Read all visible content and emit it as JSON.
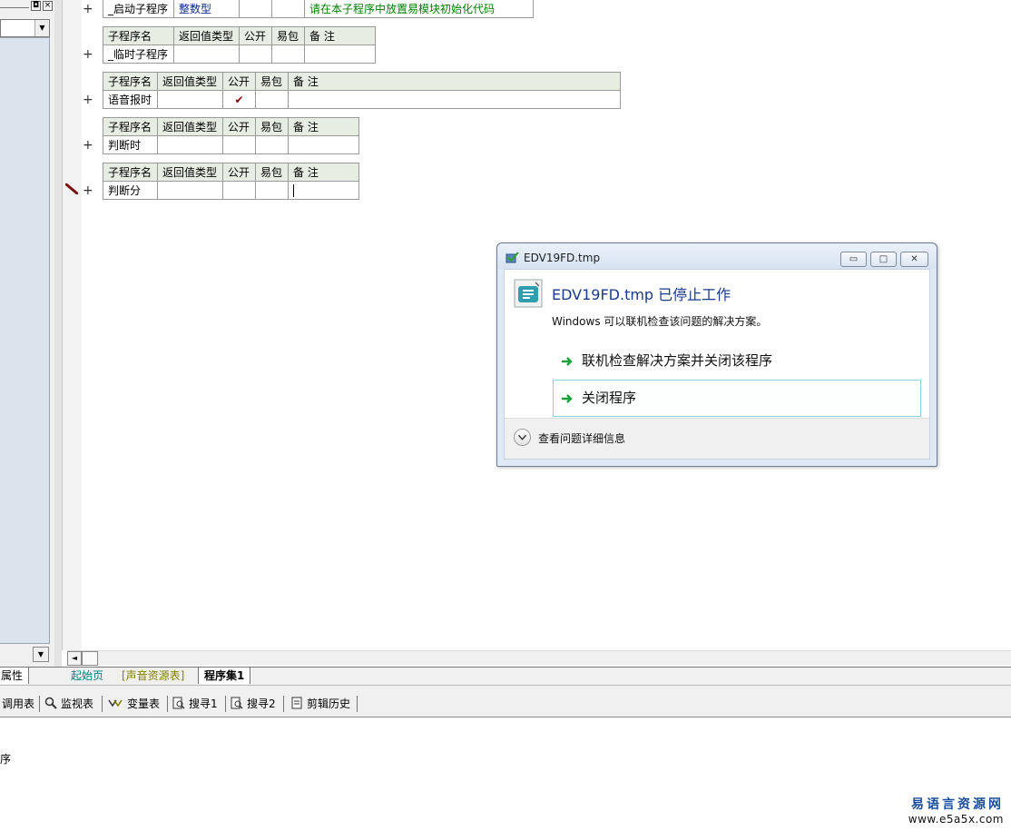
{
  "left_panel": {
    "restore_glyph": "◘",
    "close_glyph": "×",
    "combo_arrow": "▼",
    "scroll_arrow": "▼"
  },
  "editor": {
    "subroutines": [
      {
        "header": null,
        "row": [
          "_启动子程序",
          "整数型",
          "",
          "",
          "请在本子程序中放置易模块初始化代码"
        ]
      },
      {
        "header": [
          "子程序名",
          "返回值类型",
          "公开",
          "易包",
          "备 注"
        ],
        "row": [
          "_临时子程序",
          "",
          "",
          "",
          ""
        ]
      },
      {
        "header": [
          "子程序名",
          "返回值类型",
          "公开",
          "易包",
          "备 注"
        ],
        "row": [
          "语音报时",
          "",
          "✔",
          "",
          ""
        ]
      },
      {
        "header": [
          "子程序名",
          "返回值类型",
          "公开",
          "易包",
          "备 注"
        ],
        "row": [
          "判断时",
          "",
          "",
          "",
          ""
        ]
      },
      {
        "header": [
          "子程序名",
          "返回值类型",
          "公开",
          "易包",
          "备 注"
        ],
        "row": [
          "判断分",
          "",
          "",
          "",
          ""
        ]
      }
    ],
    "expand_glyph": "+",
    "scroll_left": "◄"
  },
  "tabs": {
    "properties": "属性",
    "start_page": "起始页",
    "sound_table": "[声音资源表]",
    "program_set": "程序集1"
  },
  "bottom_toolbar": {
    "items": [
      "调用表",
      "监视表",
      "变量表",
      "搜寻1",
      "搜寻2",
      "剪辑历史"
    ]
  },
  "output": {
    "text": "序"
  },
  "watermark": {
    "line1": "易语言资源网",
    "line2": "www.e5a5x.com"
  },
  "dialog": {
    "title": "EDV19FD.tmp",
    "heading": "EDV19FD.tmp 已停止工作",
    "description": "Windows 可以联机检查该问题的解决方案。",
    "option_online": "联机检查解决方案并关闭该程序",
    "option_close": "关闭程序",
    "details": "查看问题详细信息",
    "min_glyph": "▭",
    "max_glyph": "□",
    "close_glyph": "✕"
  },
  "colors": {
    "accent_heading": "#1a3a8c",
    "green_arrow": "#1aa33a",
    "table_header_bg": "#e8ede3",
    "comment_green": "#008000"
  }
}
